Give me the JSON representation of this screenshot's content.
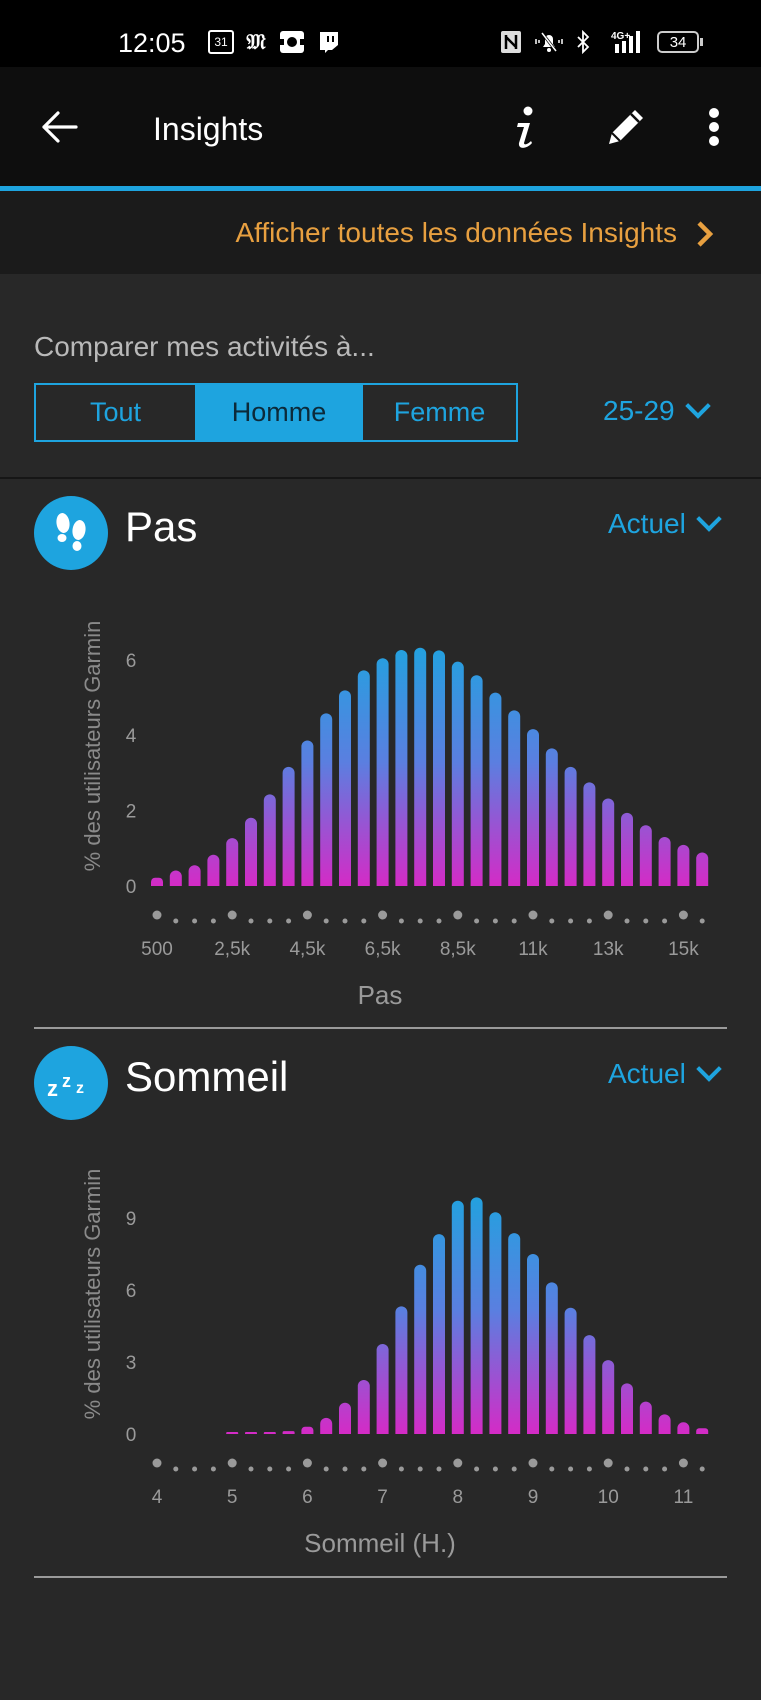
{
  "status_bar": {
    "time": "12:05",
    "left_icons": [
      "calendar-31-icon",
      "le-monde-icon",
      "hinge-icon",
      "twitch-icon"
    ],
    "calendar_day": "31",
    "network": "4G+",
    "battery": "34"
  },
  "app_bar": {
    "title": "Insights",
    "back_icon": "arrow-left-icon",
    "actions": [
      "info-icon",
      "pencil-icon",
      "more-vert-icon"
    ]
  },
  "link_bar": {
    "label": "Afficher toutes les données Insights",
    "chevron": "›"
  },
  "compare": {
    "label": "Comparer mes activités à...",
    "segments": [
      {
        "label": "Tout",
        "active": false
      },
      {
        "label": "Homme",
        "active": true
      },
      {
        "label": "Femme",
        "active": false
      }
    ],
    "age_range": "25-29"
  },
  "colors": {
    "accent": "#1ea4df",
    "link": "#e8a040",
    "bar_top": "#1ea4df",
    "bar_bottom": "#d42bc6",
    "background": "#282828"
  },
  "sections": [
    {
      "title": "Pas",
      "icon": "footsteps-icon",
      "period": "Actuel"
    },
    {
      "title": "Sommeil",
      "icon": "zzz-sleep-icon",
      "icon_text": "ZZz",
      "period": "Actuel"
    }
  ],
  "chart_data": [
    {
      "type": "bar",
      "title": "Pas",
      "xlabel": "Pas",
      "ylabel": "% des utilisateurs Garmin",
      "ylim": [
        0,
        6.6
      ],
      "yticks": [
        0,
        2,
        4,
        6
      ],
      "x": [
        500,
        1000,
        1500,
        2000,
        2500,
        3000,
        3500,
        4000,
        4500,
        5000,
        5500,
        6000,
        6500,
        7000,
        7500,
        8000,
        8500,
        9000,
        9500,
        10000,
        10500,
        11000,
        11500,
        12000,
        12500,
        13000,
        13500,
        14000,
        14500,
        15000
      ],
      "xtick_labels": [
        "500",
        "",
        "",
        "",
        "2,5k",
        "",
        "",
        "",
        "4,5k",
        "",
        "",
        "",
        "6,5k",
        "",
        "",
        "",
        "8,5k",
        "",
        "",
        "",
        "11k",
        "",
        "",
        "",
        "13k",
        "",
        "",
        "",
        "15k",
        ""
      ],
      "values": [
        0.22,
        0.41,
        0.55,
        0.83,
        1.27,
        1.81,
        2.43,
        3.16,
        3.86,
        4.58,
        5.19,
        5.72,
        6.04,
        6.26,
        6.32,
        6.25,
        5.95,
        5.59,
        5.13,
        4.66,
        4.16,
        3.65,
        3.16,
        2.75,
        2.32,
        1.94,
        1.61,
        1.3,
        1.09,
        0.89
      ],
      "grid": false,
      "legend": "none"
    },
    {
      "type": "bar",
      "title": "Sommeil",
      "xlabel": "Sommeil (H.)",
      "ylabel": "% des utilisateurs Garmin",
      "ylim": [
        0,
        10.3
      ],
      "yticks": [
        0,
        3,
        6,
        9
      ],
      "x": [
        4,
        4.25,
        4.5,
        4.75,
        5,
        5.25,
        5.5,
        5.75,
        6,
        6.25,
        6.5,
        6.75,
        7,
        7.25,
        7.5,
        7.75,
        8,
        8.25,
        8.5,
        8.75,
        9,
        9.25,
        9.5,
        9.75,
        10,
        10.25,
        10.5,
        10.75,
        11,
        11.25
      ],
      "xtick_labels": [
        "4",
        "",
        "",
        "",
        "5",
        "",
        "",
        "",
        "6",
        "",
        "",
        "",
        "7",
        "",
        "",
        "",
        "8",
        "",
        "",
        "",
        "9",
        "",
        "",
        "",
        "10",
        "",
        "",
        "",
        "11",
        ""
      ],
      "values": [
        0,
        0,
        0,
        0,
        0.02,
        0.04,
        0.06,
        0.12,
        0.3,
        0.67,
        1.3,
        2.25,
        3.75,
        5.32,
        7.05,
        8.33,
        9.72,
        9.86,
        9.24,
        8.37,
        7.5,
        6.32,
        5.26,
        4.12,
        3.08,
        2.11,
        1.35,
        0.82,
        0.49,
        0.24
      ],
      "grid": false,
      "legend": "none"
    }
  ]
}
